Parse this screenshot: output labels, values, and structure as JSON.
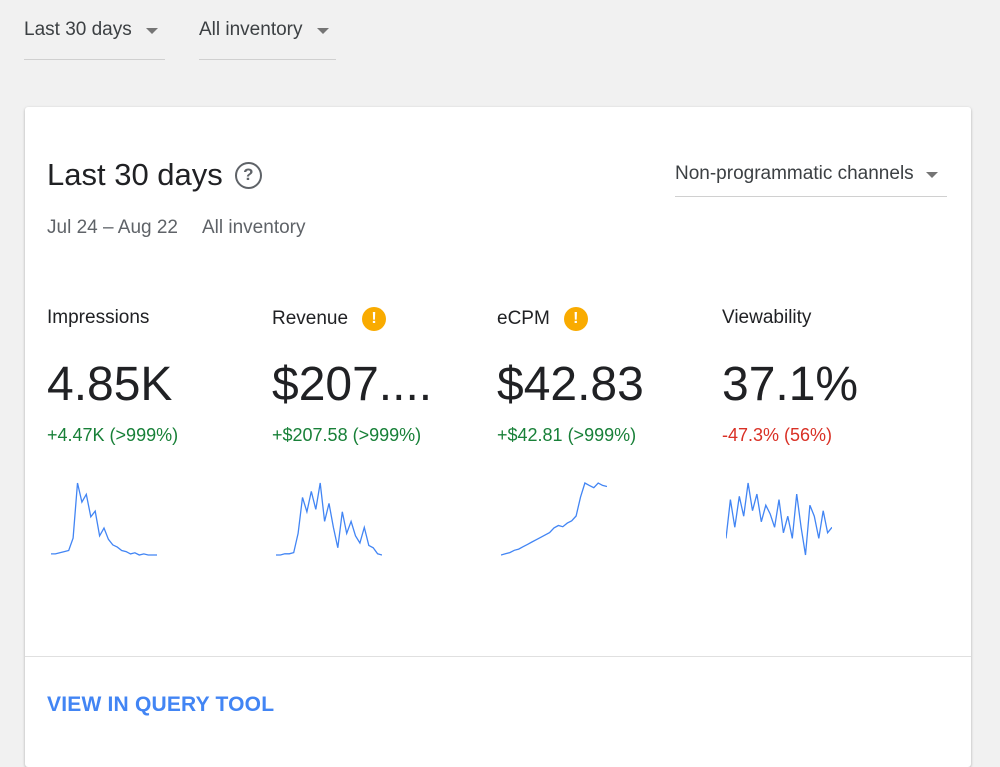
{
  "filters": {
    "date_range": "Last 30 days",
    "inventory": "All inventory"
  },
  "card": {
    "title": "Last 30 days",
    "date_span": "Jul 24 – Aug 22",
    "inventory": "All inventory",
    "channel_select": "Non-programmatic channels",
    "footer_link": "VIEW IN QUERY TOOL"
  },
  "metrics": [
    {
      "label": "Impressions",
      "value": "4.85K",
      "delta": "+4.47K (>999%)",
      "trend": "up",
      "warning": false,
      "sparkline": [
        2,
        2,
        3,
        4,
        5,
        16,
        65,
        48,
        55,
        35,
        40,
        18,
        25,
        15,
        10,
        8,
        5,
        4,
        2,
        3,
        1,
        2,
        1,
        1,
        1
      ]
    },
    {
      "label": "Revenue",
      "value": "$207....",
      "delta": "+$207.58 (>999%)",
      "trend": "up",
      "warning": true,
      "sparkline": [
        2,
        2,
        3,
        3,
        4,
        20,
        50,
        38,
        55,
        40,
        62,
        30,
        45,
        25,
        8,
        38,
        20,
        30,
        18,
        12,
        25,
        10,
        8,
        3,
        2
      ]
    },
    {
      "label": "eCPM",
      "value": "$42.83",
      "delta": "+$42.81 (>999%)",
      "trend": "up",
      "warning": true,
      "sparkline": [
        1,
        2,
        3,
        5,
        6,
        8,
        10,
        12,
        14,
        16,
        18,
        20,
        24,
        26,
        25,
        28,
        30,
        34,
        50,
        62,
        60,
        58,
        62,
        60,
        59
      ]
    },
    {
      "label": "Viewability",
      "value": "37.1%",
      "delta": "-47.3% (56%)",
      "trend": "down",
      "warning": false,
      "sparkline": [
        20,
        55,
        30,
        58,
        40,
        70,
        45,
        60,
        35,
        50,
        42,
        30,
        55,
        25,
        40,
        20,
        60,
        30,
        5,
        50,
        40,
        20,
        45,
        25,
        30
      ]
    }
  ],
  "colors": {
    "sparkline": "#4285f4",
    "positive": "#188038",
    "negative": "#d93025",
    "link": "#4285f4",
    "warning": "#f9ab00"
  }
}
